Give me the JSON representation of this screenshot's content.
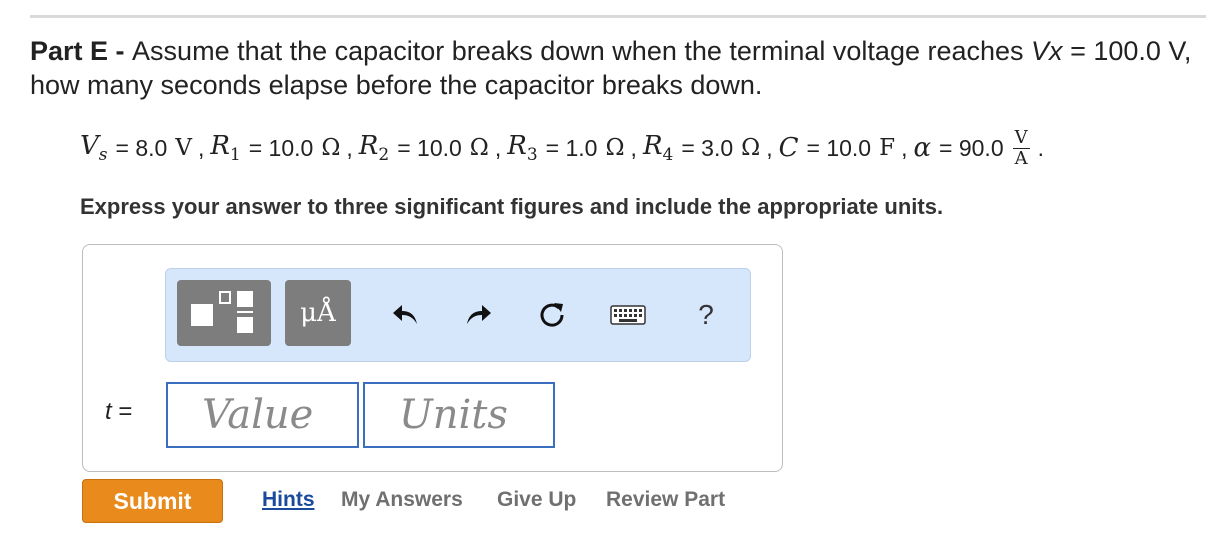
{
  "question": {
    "part_label": "Part E",
    "dash": " - ",
    "text_before": "Assume that the capacitor breaks down when the terminal voltage reaches ",
    "vx": "Vx",
    "text_after": " = 100.0 V, how many seconds elapse before the capacitor breaks down."
  },
  "given": {
    "vs_sym": "V",
    "vs_sub": "s",
    "vs_val": "= 8.0",
    "vs_unit": "V",
    "r1_sym": "R",
    "r1_sub": "1",
    "r1_val": "= 10.0",
    "r1_unit": "Ω",
    "r2_sym": "R",
    "r2_sub": "2",
    "r2_val": "= 10.0",
    "r2_unit": "Ω",
    "r3_sym": "R",
    "r3_sub": "3",
    "r3_val": "= 1.0",
    "r3_unit": "Ω",
    "r4_sym": "R",
    "r4_sub": "4",
    "r4_val": "= 3.0",
    "r4_unit": "Ω",
    "c_sym": "C",
    "c_val": "= 10.0",
    "c_unit": "F",
    "alpha_sym": "α",
    "alpha_val": "= 90.0",
    "alpha_unit_num": "V",
    "alpha_unit_den": "A",
    "comma": ",",
    "period": "."
  },
  "instruction": "Express your answer to three significant figures and include the appropriate units.",
  "toolbar": {
    "units_label": "μÅ",
    "help_label": "?",
    "icons": [
      "templates-icon",
      "units-icon",
      "undo-icon",
      "redo-icon",
      "reset-icon",
      "keyboard-icon",
      "help-icon"
    ]
  },
  "answer": {
    "var_label": "t",
    "equals": "=",
    "value_placeholder": "Value",
    "units_placeholder": "Units"
  },
  "actions": {
    "submit": "Submit",
    "hints": "Hints",
    "my_answers": "My Answers",
    "give_up": "Give Up",
    "review_part": "Review Part"
  },
  "colors": {
    "submit_bg": "#e88a1c",
    "toolbar_bg": "#d6e6fb",
    "field_border": "#3a6ec1",
    "hint_link": "#1a4a9c"
  }
}
